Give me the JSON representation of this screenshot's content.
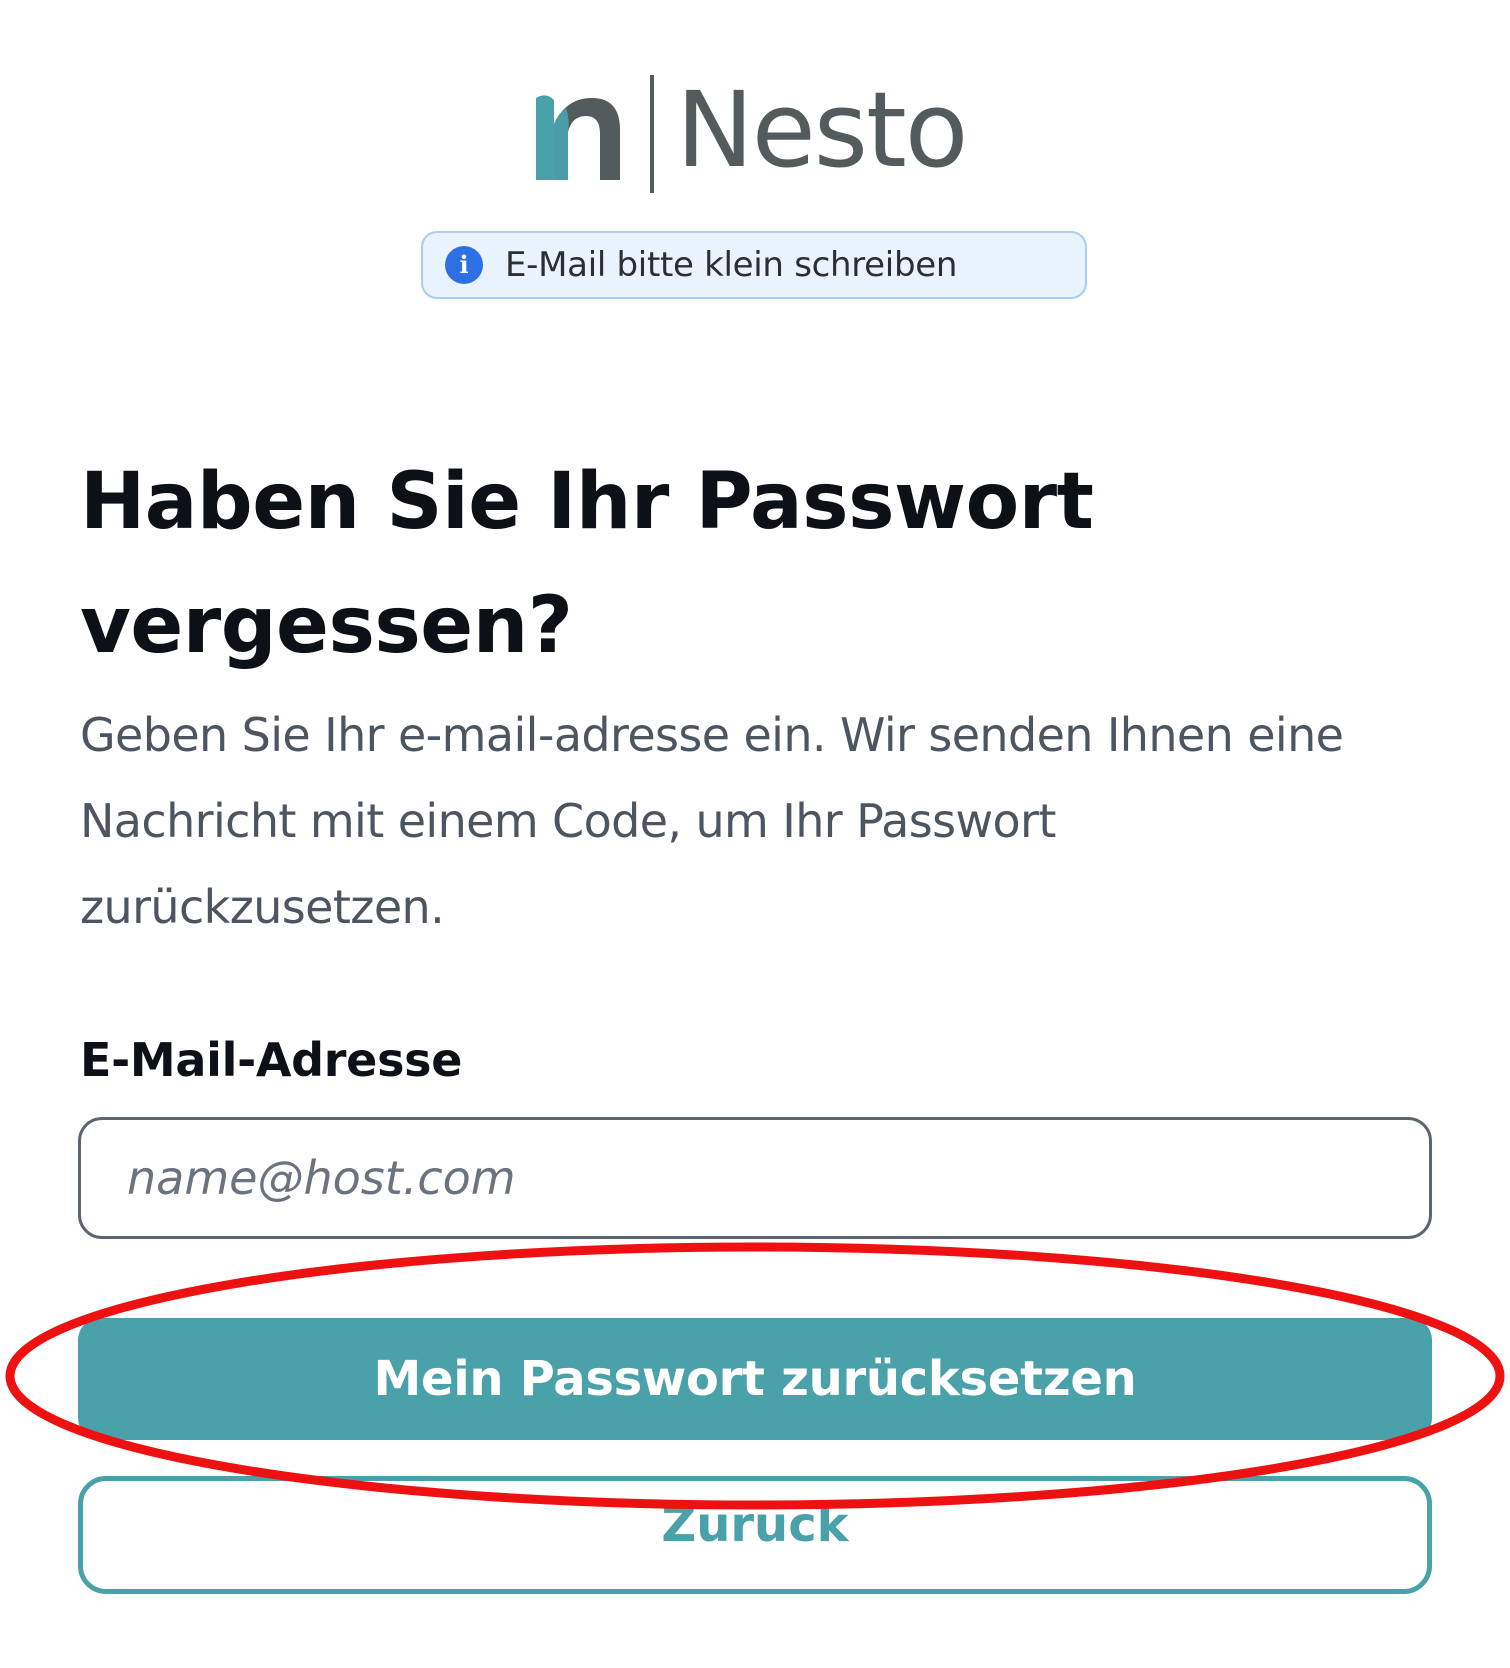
{
  "brand": {
    "name": "Nesto",
    "colors": {
      "logo_teal": "#4aa1aa",
      "logo_gray": "#545b5c"
    }
  },
  "notice": {
    "icon": "info-icon",
    "text": "E-Mail bitte klein schreiben",
    "colors": {
      "background": "#e9f3fe",
      "border": "#a9cdf3",
      "icon": "#2f6fe4"
    }
  },
  "page": {
    "title": "Haben Sie Ihr Passwort vergessen?",
    "description": "Geben Sie Ihr e-mail-adresse ein. Wir senden Ihnen eine Nachricht mit einem Code, um Ihr Passwort zurückzusetzen."
  },
  "form": {
    "email_label": "E-Mail-Adresse",
    "email_value": "",
    "email_placeholder": "name@host.com",
    "submit_label": "Mein Passwort zurücksetzen",
    "back_label": "Zurück"
  },
  "theme": {
    "primary": "#4aa1aa",
    "text_dark": "#0d1117",
    "text_muted": "#4d5560",
    "annotation": "#ee1111"
  }
}
